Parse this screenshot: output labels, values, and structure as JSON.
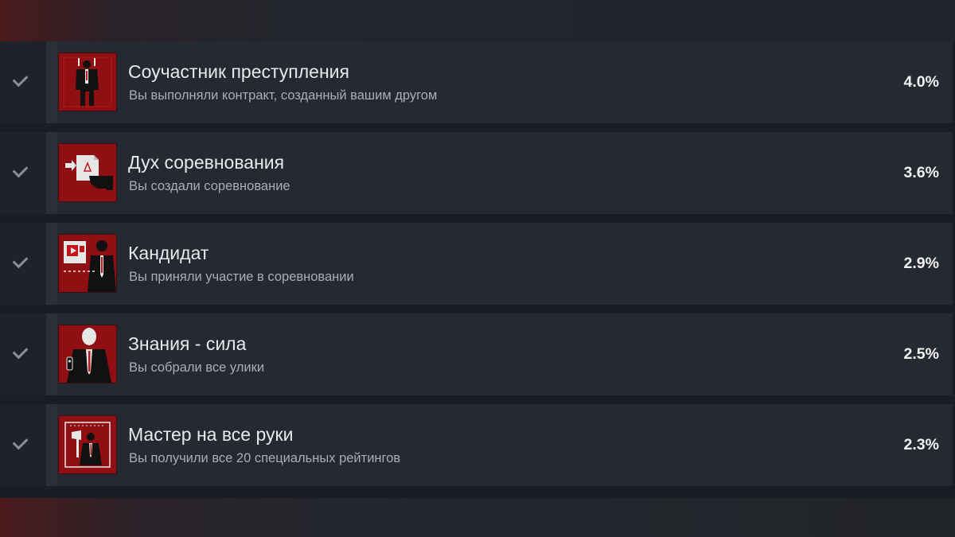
{
  "achievements": [
    {
      "title": "Соучастник преступления",
      "description": "Вы выполняли контракт, созданный вашим другом",
      "percent": "4.0%",
      "icon": "partners-in-crime-badge-icon",
      "unlocked": true
    },
    {
      "title": "Дух соревнования",
      "description": "Вы создали соревнование",
      "percent": "3.6%",
      "icon": "hand-delivering-contract-badge-icon",
      "unlocked": true
    },
    {
      "title": "Кандидат",
      "description": "Вы приняли участие в соревновании",
      "percent": "2.9%",
      "icon": "video-contract-agent-badge-icon",
      "unlocked": true
    },
    {
      "title": "Знания - сила",
      "description": "Вы собрали все улики",
      "percent": "2.5%",
      "icon": "agent-with-remote-badge-icon",
      "unlocked": true
    },
    {
      "title": "Мастер на все руки",
      "description": "Вы получили все 20 специальных рейтингов",
      "percent": "2.3%",
      "icon": "agent-with-axe-badge-icon",
      "unlocked": true
    }
  ],
  "colors": {
    "row_background": "#252932",
    "badge_red": "#8f0f12",
    "check_gray": "#8a8e96"
  }
}
